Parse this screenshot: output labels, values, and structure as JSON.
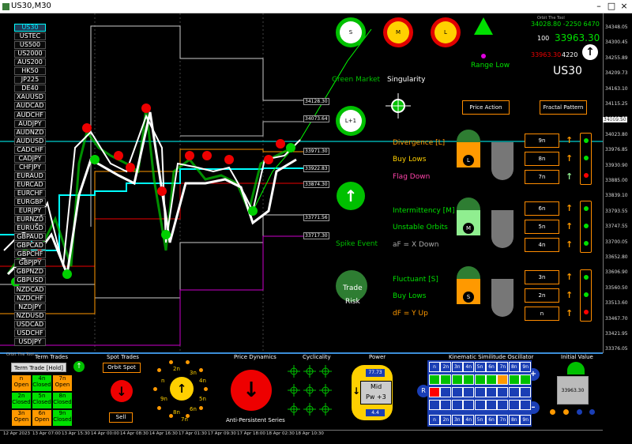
{
  "window": {
    "title": "US30,M30",
    "buttons": [
      "–",
      "□",
      "×"
    ]
  },
  "symbols": [
    "US30",
    "USTEC",
    "US500",
    "US2000",
    "AUS200",
    "HK50",
    "JP225",
    "DE40",
    "XAUUSD",
    "AUDCAD",
    "AUDCHF",
    "AUDJPY",
    "AUDNZD",
    "AUDUSD",
    "CADCHF",
    "CADJPY",
    "CHFJPY",
    "EURAUD",
    "EURCAD",
    "EURCHF",
    "EURGBP",
    "EURJPY",
    "EURNZD",
    "EURUSD",
    "GBPAUD",
    "GBPCAD",
    "GBPCHF",
    "GBPJPY",
    "GBPNZD",
    "GBPUSD",
    "NZDCAD",
    "NZDCHF",
    "NZDJPY",
    "NZDUSD",
    "USDCAD",
    "USDCHF",
    "USDJPY"
  ],
  "header": {
    "orbit_link": "Orbit The Tool",
    "pos_line": "34028.80 -2250 6470",
    "level": "100",
    "price": "33963.30",
    "neg_line": "33963.30",
    "neg_count": "4220",
    "symbol": "US30",
    "range_low": "Range Low"
  },
  "price_axis": [
    "34348.05",
    "34300.45",
    "34255.89",
    "34209.73",
    "34163.10",
    "34115.25",
    "34069.75",
    "34023.80",
    "33976.85",
    "33930.90",
    "33885.00",
    "33839.10",
    "33793.55",
    "33747.55",
    "33700.05",
    "33652.80",
    "33606.90",
    "33560.50",
    "33513.60",
    "33467.70",
    "33421.95",
    "33376.05"
  ],
  "price_current": "34009.50",
  "price_tags": [
    "34128.30",
    "34073.64",
    "33971.30",
    "33922.83",
    "33874.30",
    "33771.56",
    "33717.30"
  ],
  "signals": {
    "sml": [
      {
        "letter": "S",
        "color": "#00c000"
      },
      {
        "letter": "M",
        "color": "#e00000"
      },
      {
        "letter": "L",
        "color": "#e00000"
      }
    ],
    "green_market": "Green Market",
    "singularity": "Singularity",
    "lplus": "L+1",
    "spike_event": "Spike Event",
    "trade": "Trade",
    "risk": "Risk",
    "price_action": "Price Action",
    "fractal_pattern": "Fractal Pattern"
  },
  "groups": [
    {
      "title": "Divergence [L]",
      "line2": "Buy Lows",
      "line3": "Flag Down",
      "c1": "#ff9900",
      "c2": "#ffd000",
      "c3": "#ff44aa",
      "gauge": "L",
      "boxes": [
        "9n",
        "8n",
        "7n"
      ],
      "arrows": [
        "↑",
        "↑",
        "↑"
      ],
      "lights": [
        "#00e000",
        "#00e000",
        "#ff0000"
      ]
    },
    {
      "title": "Intermittency [M]",
      "line2": "Unstable Orbits",
      "line3": "aF = X Down",
      "c1": "#00e000",
      "c2": "#00e000",
      "c3": "#aaaaaa",
      "gauge": "M",
      "boxes": [
        "6n",
        "5n",
        "4n"
      ],
      "arrows": [
        "↑",
        "↑",
        "↑"
      ],
      "lights": [
        "#00e000",
        "#00e000",
        "#00e000"
      ]
    },
    {
      "title": "Fluctuant [S]",
      "line2": "Buy Lows",
      "line3": "dF = Y Up",
      "c1": "#00e000",
      "c2": "#00e000",
      "c3": "#ff9900",
      "gauge": "S",
      "boxes": [
        "3n",
        "2n",
        "n"
      ],
      "arrows": [
        "↑",
        "↑",
        "↑"
      ],
      "lights": [
        "#00e000",
        "#00e000",
        "#ff0000"
      ]
    }
  ],
  "bottom": {
    "orbit_tool": "Orbit The Tool",
    "term_trades": "Term Trades",
    "term_button": "Term Trade [Hold]",
    "term_cells": [
      [
        "n",
        "Open",
        "#ff9900"
      ],
      [
        "4n",
        "Closed",
        "#00e000"
      ],
      [
        "7n",
        "Open",
        "#ff9900"
      ],
      [
        "2n",
        "Closed",
        "#00e000"
      ],
      [
        "5n",
        "Closed",
        "#00e000"
      ],
      [
        "8n",
        "Closed",
        "#00e000"
      ],
      [
        "3n",
        "Open",
        "#ff9900"
      ],
      [
        "6n",
        "Open",
        "#ff9900"
      ],
      [
        "9n",
        "Closed",
        "#00e000"
      ]
    ],
    "spot_trades": "Spot Trades",
    "orbit_spot": "Orbit Spot",
    "sell": "Sell",
    "ring": [
      "n",
      "2n",
      "3n",
      "4n",
      "5n",
      "6n",
      "7n",
      "8n",
      "9n"
    ],
    "price_dynamics": "Price Dynamics",
    "anti_persistent": "Anti-Persistent Series",
    "cyclicality": "Cyclicality",
    "power": "Power",
    "power_top": "77.73",
    "power_mid": "Mid",
    "power_pw": "Pw +3",
    "power_bot": "4.4",
    "kinematic": "Kinematic Similitude Oscillator",
    "k_headers": [
      "n",
      "2n",
      "3n",
      "4n",
      "5n",
      "6n",
      "7n",
      "8n",
      "9n"
    ],
    "k_rows": [
      [
        "#00c000",
        "#00c000",
        "#00c000",
        "#00c000",
        "#00c000",
        "#00c000",
        "#ff9900",
        "#00c000",
        "#00c000"
      ],
      [
        "#ff0000",
        "#1a3eb5",
        "#1a3eb5",
        "#1a3eb5",
        "#1a3eb5",
        "#1a3eb5",
        "#1a3eb5",
        "#1a3eb5",
        "#1a3eb5"
      ],
      [
        "#1a3eb5",
        "#1a3eb5",
        "#1a3eb5",
        "#1a3eb5",
        "#1a3eb5",
        "#1a3eb5",
        "#1a3eb5",
        "#1a3eb5",
        "#1a3eb5"
      ]
    ],
    "k_left": "R",
    "k_plus": "+",
    "k_minus": "–",
    "initial_value": "Initial Value",
    "init_price": "33963.30"
  },
  "time_axis": [
    "12 Apr 2023",
    "13 Apr 07:00",
    "13 Apr 15:30",
    "14 Apr 00:00",
    "14 Apr 08:30",
    "14 Apr 16:30",
    "17 Apr 01:30",
    "17 Apr 09:30",
    "17 Apr 18:00",
    "18 Apr 02:30",
    "18 Apr 10:30"
  ]
}
